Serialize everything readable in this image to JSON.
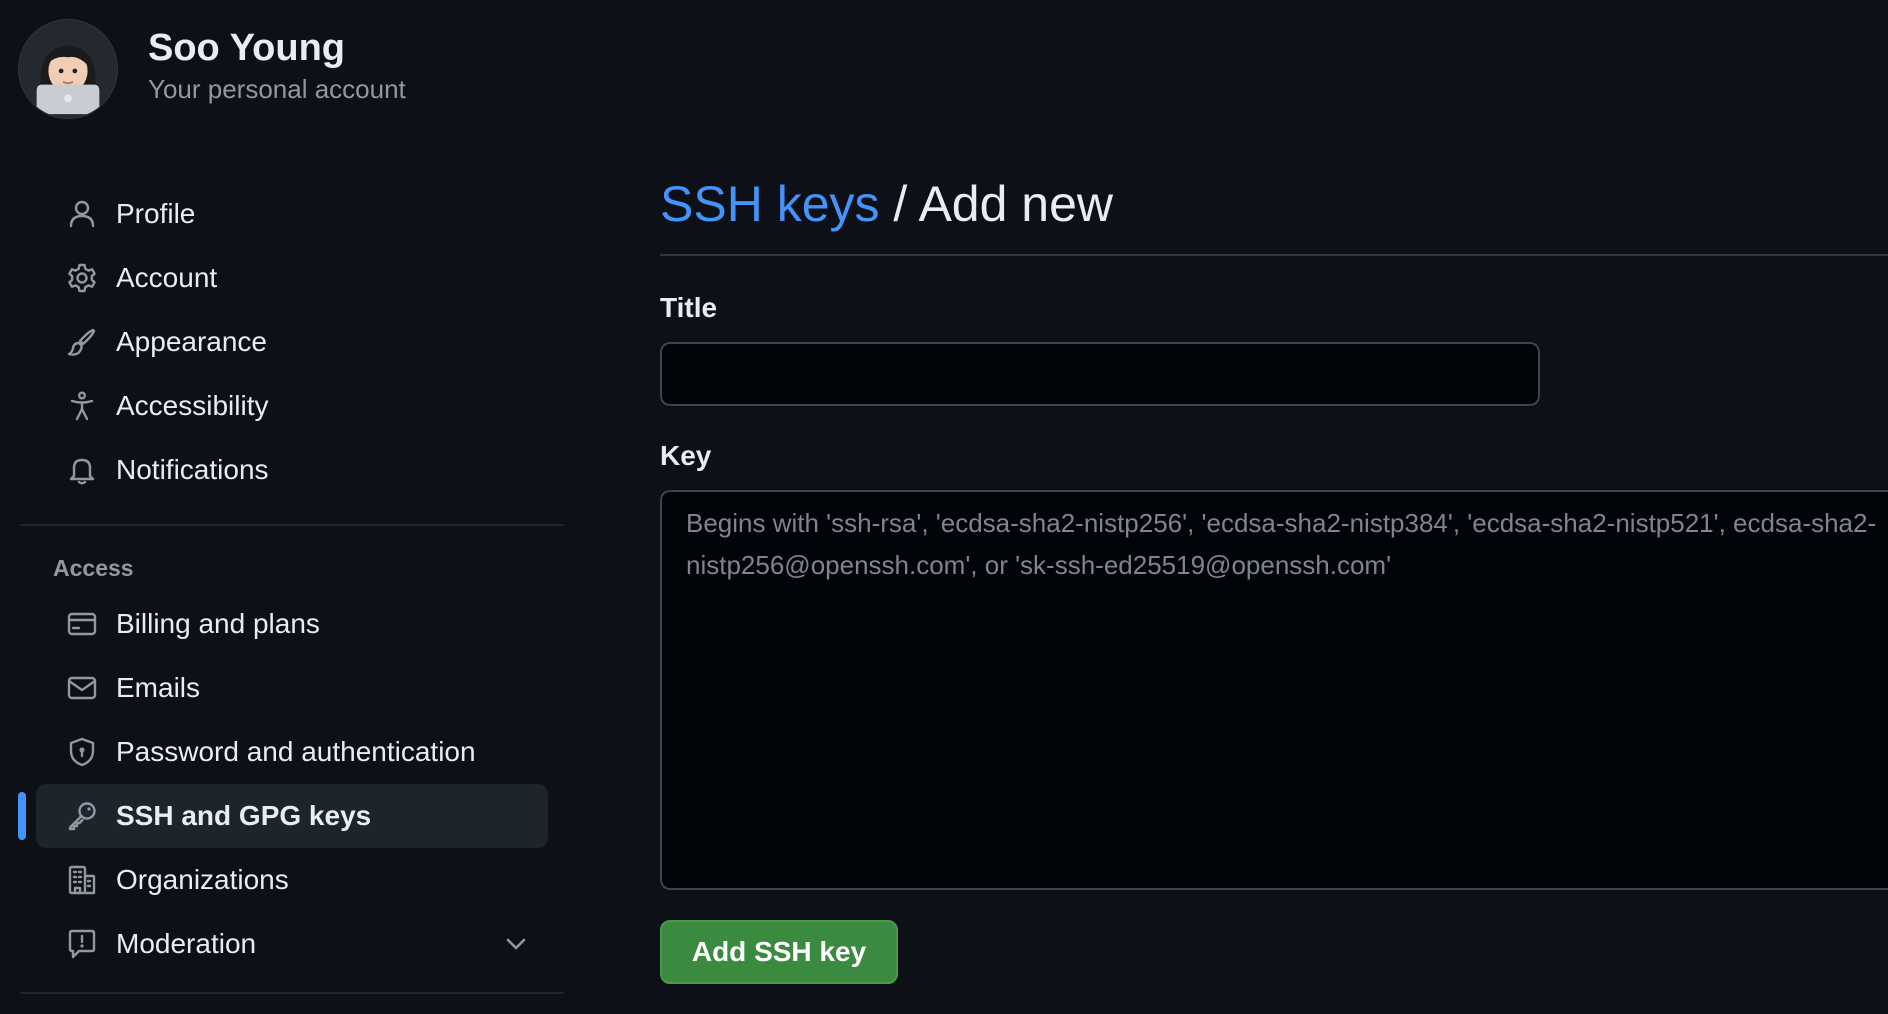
{
  "account": {
    "name": "Soo Young",
    "subtitle": "Your personal account"
  },
  "sidebar": {
    "items": [
      {
        "label": "Profile",
        "icon": "person-icon"
      },
      {
        "label": "Account",
        "icon": "gear-icon"
      },
      {
        "label": "Appearance",
        "icon": "paintbrush-icon"
      },
      {
        "label": "Accessibility",
        "icon": "accessibility-icon"
      },
      {
        "label": "Notifications",
        "icon": "bell-icon"
      }
    ],
    "access_heading": "Access",
    "access_items": [
      {
        "label": "Billing and plans",
        "icon": "credit-card-icon"
      },
      {
        "label": "Emails",
        "icon": "mail-icon"
      },
      {
        "label": "Password and authentication",
        "icon": "shield-icon"
      },
      {
        "label": "SSH and GPG keys",
        "icon": "key-icon",
        "active": true
      },
      {
        "label": "Organizations",
        "icon": "organization-icon"
      },
      {
        "label": "Moderation",
        "icon": "report-icon",
        "expandable": true
      }
    ]
  },
  "main": {
    "breadcrumb_link": "SSH keys",
    "breadcrumb_separator": " / ",
    "breadcrumb_current": "Add new",
    "title_label": "Title",
    "title_value": "",
    "key_label": "Key",
    "key_placeholder": "Begins with 'ssh-rsa', 'ecdsa-sha2-nistp256', 'ecdsa-sha2-nistp384', 'ecdsa-sha2-nistp521', ecdsa-sha2-nistp256@openssh.com', or 'sk-ssh-ed25519@openssh.com'",
    "submit_label": "Add SSH key"
  },
  "colors": {
    "background": "#0d1117",
    "link": "#4493f8",
    "active_marker": "#4493f8",
    "button": "#3a8a3f"
  }
}
